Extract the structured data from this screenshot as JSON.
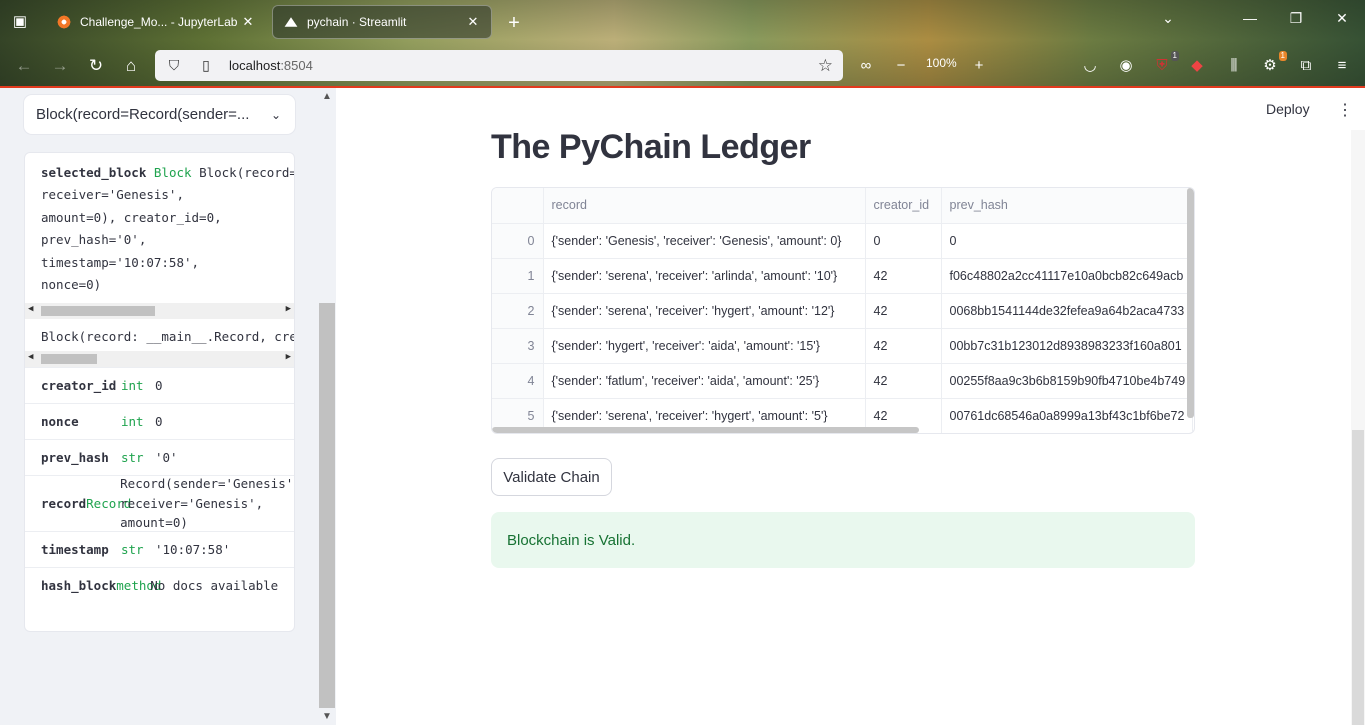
{
  "browser": {
    "tabs": [
      {
        "title": "Challenge_Mo... - JupyterLab",
        "close": "✕"
      },
      {
        "title": "pychain · Streamlit",
        "close": "✕"
      }
    ],
    "new_tab": "+",
    "url_host": "localhost",
    "url_port": ":8504",
    "zoom": "100%",
    "badges": {
      "ublock": "1",
      "ext": "1"
    }
  },
  "sidebar": {
    "select_value": "Block(record=Record(sender=...",
    "code_lines": [
      {
        "key": "selected_block",
        "type": "Block",
        "text": "Block(record=Record(sender='Genesis',"
      },
      {
        "text": "receiver='Genesis',"
      },
      {
        "text": "amount=0), creator_id=0,"
      },
      {
        "text": "prev_hash='0',"
      },
      {
        "text": "timestamp='10:07:58',"
      },
      {
        "text": "nonce=0)"
      }
    ],
    "signature": "Block(record: __main__.Record, creator_id: int, prev_hash: str, timestamp: str, nonce: int) -> None",
    "attributes": [
      {
        "name": "creator_id",
        "type": "int",
        "value": "0"
      },
      {
        "name": "nonce",
        "type": "int",
        "value": "0"
      },
      {
        "name": "prev_hash",
        "type": "str",
        "value": "'0'"
      },
      {
        "name": "record",
        "type": "Record",
        "value": "Record(sender='Genesis',\nreceiver='Genesis',\namount=0)"
      },
      {
        "name": "timestamp",
        "type": "str",
        "value": "'10:07:58'"
      },
      {
        "name": "hash_block",
        "type": "method",
        "value": "No docs available"
      }
    ]
  },
  "header": {
    "deploy": "Deploy",
    "menu": "⋮"
  },
  "main": {
    "title": "The PyChain Ledger",
    "columns": [
      "",
      "record",
      "creator_id",
      "prev_hash"
    ],
    "rows": [
      {
        "index": "0",
        "record": "{'sender': 'Genesis', 'receiver': 'Genesis', 'amount': 0}",
        "creator_id": "0",
        "prev_hash": "0"
      },
      {
        "index": "1",
        "record": "{'sender': 'serena', 'receiver': 'arlinda', 'amount': '10'}",
        "creator_id": "42",
        "prev_hash": "f06c48802a2cc41117e10a0bcb82c649acb"
      },
      {
        "index": "2",
        "record": "{'sender': 'serena', 'receiver': 'hygert', 'amount': '12'}",
        "creator_id": "42",
        "prev_hash": "0068bb1541144de32fefea9a64b2aca4733"
      },
      {
        "index": "3",
        "record": "{'sender': 'hygert', 'receiver': 'aida', 'amount': '15'}",
        "creator_id": "42",
        "prev_hash": "00bb7c31b123012d8938983233f160a801"
      },
      {
        "index": "4",
        "record": "{'sender': 'fatlum', 'receiver': 'aida', 'amount': '25'}",
        "creator_id": "42",
        "prev_hash": "00255f8aa9c3b6b8159b90fb4710be4b749"
      },
      {
        "index": "5",
        "record": "{'sender': 'serena', 'receiver': 'hygert', 'amount': '5'}",
        "creator_id": "42",
        "prev_hash": "00761dc68546a0a8999a13bf43c1bf6be72"
      }
    ],
    "validate_button": "Validate Chain",
    "status": "Blockchain is Valid."
  }
}
